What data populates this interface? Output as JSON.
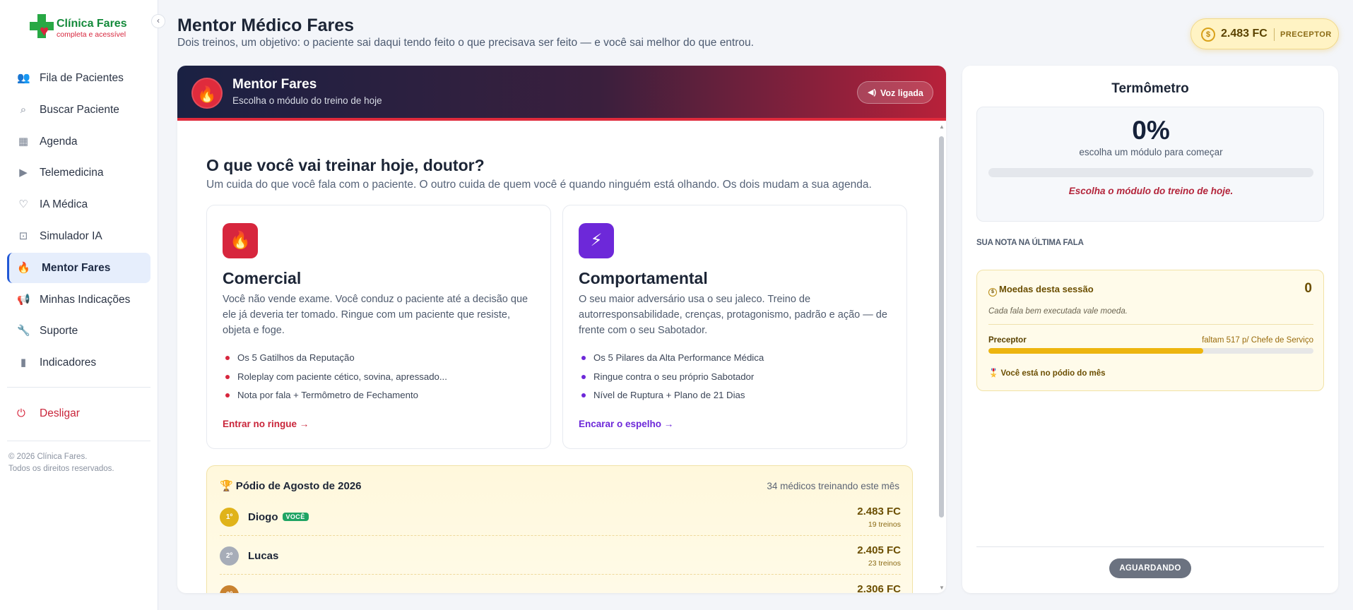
{
  "brand": {
    "name": "Clínica Fares",
    "tagline": "completa e acessível",
    "colors": {
      "green": "#27a844",
      "red": "#d7263d",
      "accent": "#2158d6"
    }
  },
  "sidebar": {
    "items": [
      {
        "label": "Fila de Pacientes",
        "icon": "users-icon"
      },
      {
        "label": "Buscar Paciente",
        "icon": "search-icon"
      },
      {
        "label": "Agenda",
        "icon": "calendar-icon"
      },
      {
        "label": "Telemedicina",
        "icon": "video-icon"
      },
      {
        "label": "IA Médica",
        "icon": "heart-pulse-icon"
      },
      {
        "label": "Simulador IA",
        "icon": "robot-icon"
      },
      {
        "label": "Mentor Fares",
        "icon": "flame-icon",
        "active": true
      },
      {
        "label": "Minhas Indicações",
        "icon": "megaphone-icon"
      },
      {
        "label": "Suporte",
        "icon": "wrench-icon"
      },
      {
        "label": "Indicadores",
        "icon": "bar-chart-icon"
      }
    ],
    "logout": "Desligar",
    "copyright_line1": "© 2026 Clínica Fares.",
    "copyright_line2": "Todos os direitos reservados."
  },
  "header": {
    "title": "Mentor Médico Fares",
    "subtitle": "Dois treinos, um objetivo: o paciente sai daqui tendo feito o que precisava ser feito — e você sai melhor do que entrou.",
    "coins": "2.483 FC",
    "rank": "PRECEPTOR"
  },
  "mentor": {
    "title": "Mentor Fares",
    "subtitle": "Escolha o módulo do treino de hoje",
    "voice": "Voz ligada",
    "question": "O que você vai treinar hoje, doutor?",
    "question_sub": "Um cuida do que você fala com o paciente. O outro cuida de quem você é quando ninguém está olhando. Os dois mudam a sua agenda.",
    "modules": [
      {
        "title": "Comercial",
        "description": "Você não vende exame. Você conduz o paciente até a decisão que ele já deveria ter tomado. Ringue com um paciente que resiste, objeta e foge.",
        "bullets": [
          "Os 5 Gatilhos da Reputação",
          "Roleplay com paciente cético, sovina, apressado...",
          "Nota por fala + Termômetro de Fechamento"
        ],
        "cta": "Entrar no ringue →",
        "color": "#d7263d"
      },
      {
        "title": "Comportamental",
        "description": "O seu maior adversário usa o seu jaleco. Treino de autorresponsabilidade, crenças, protagonismo, padrão e ação — de frente com o seu Sabotador.",
        "bullets": [
          "Os 5 Pilares da Alta Performance Médica",
          "Ringue contra o seu próprio Sabotador",
          "Nível de Ruptura + Plano de 21 Dias"
        ],
        "cta": "Encarar o espelho →",
        "color": "#6d28d9"
      }
    ]
  },
  "podium": {
    "title": "Pódio de Agosto de 2026",
    "count": "34 médicos treinando este mês",
    "you_badge": "VOCÊ",
    "rows": [
      {
        "pos": "1º",
        "name": "Diogo",
        "coins": "2.483 FC",
        "trainings": "19 treinos",
        "color": "#e0b31a",
        "you": true
      },
      {
        "pos": "2º",
        "name": "Lucas",
        "coins": "2.405 FC",
        "trainings": "23 treinos",
        "color": "#a7adb8",
        "you": false
      },
      {
        "pos": "3º",
        "name": "",
        "coins": "2.306 FC",
        "trainings": "",
        "color": "#c9822f",
        "you": false
      }
    ]
  },
  "thermometer": {
    "title": "Termômetro",
    "percent": "0%",
    "percent_value": 0,
    "caption": "escolha um módulo para começar",
    "hint": "Escolha o módulo do treino de hoje.",
    "last_note_label": "SUA NOTA NA ÚLTIMA FALA"
  },
  "session_coins": {
    "title": "Moedas desta sessão",
    "value": "0",
    "description": "Cada fala bem executada vale moeda.",
    "level": "Preceptor",
    "next": "faltam 517 p/ Chefe de Serviço",
    "progress": 0.66,
    "podium_note": "Você está no pódio do mês"
  },
  "status": "AGUARDANDO"
}
